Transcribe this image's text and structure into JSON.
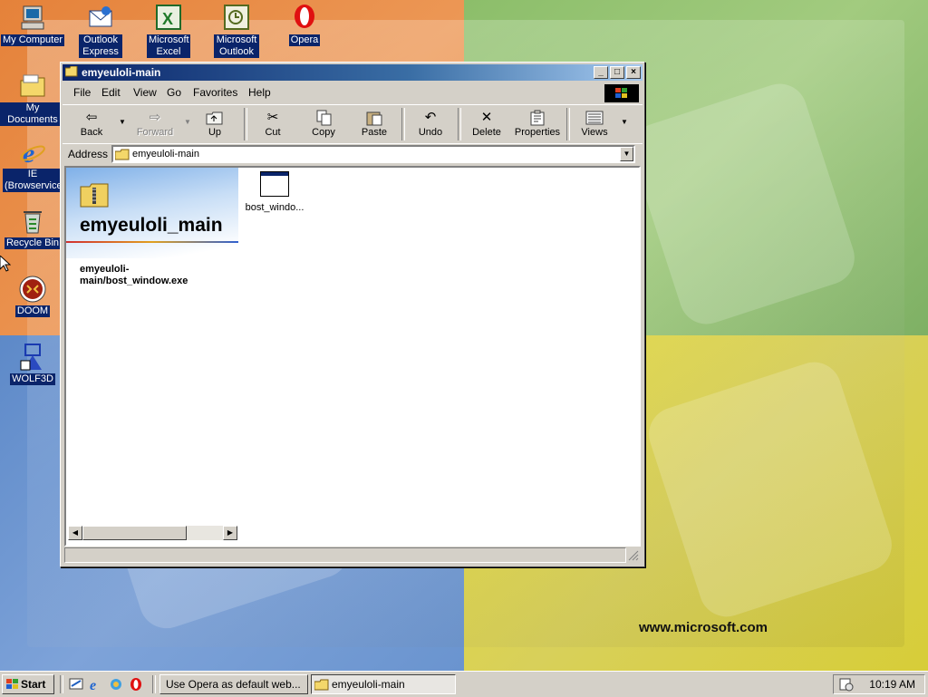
{
  "desktop": {
    "brand_text": "www.microsoft.com",
    "icons": [
      {
        "label": "My Computer",
        "icon": "computer-icon"
      },
      {
        "label": "Outlook Express",
        "icon": "outlook-express-icon"
      },
      {
        "label": "Microsoft Excel",
        "icon": "excel-icon"
      },
      {
        "label": "Microsoft Outlook",
        "icon": "outlook-icon"
      },
      {
        "label": "Opera",
        "icon": "opera-icon"
      },
      {
        "label": "My Documents",
        "icon": "folder-icon"
      },
      {
        "label": "IE (Browservice)",
        "icon": "ie-icon"
      },
      {
        "label": "Recycle Bin",
        "icon": "recycle-bin-icon"
      },
      {
        "label": "DOOM",
        "icon": "doom-icon"
      },
      {
        "label": "WOLF3D",
        "icon": "wolf3d-icon"
      }
    ]
  },
  "window": {
    "title": "emyeuloli-main",
    "menus": [
      {
        "label": "File"
      },
      {
        "label": "Edit"
      },
      {
        "label": "View"
      },
      {
        "label": "Go"
      },
      {
        "label": "Favorites"
      },
      {
        "label": "Help"
      }
    ],
    "toolbar": [
      {
        "label": "Back",
        "icon": "back-arrow-icon",
        "enabled": true
      },
      {
        "label": "Forward",
        "icon": "forward-arrow-icon",
        "enabled": false
      },
      {
        "label": "Up",
        "icon": "up-folder-icon",
        "enabled": true
      },
      {
        "label": "Cut",
        "icon": "scissors-icon",
        "enabled": true
      },
      {
        "label": "Copy",
        "icon": "copy-icon",
        "enabled": true
      },
      {
        "label": "Paste",
        "icon": "paste-icon",
        "enabled": true
      },
      {
        "label": "Undo",
        "icon": "undo-icon",
        "enabled": true
      },
      {
        "label": "Delete",
        "icon": "delete-x-icon",
        "enabled": true
      },
      {
        "label": "Properties",
        "icon": "properties-icon",
        "enabled": true
      },
      {
        "label": "Views",
        "icon": "views-icon",
        "enabled": true
      }
    ],
    "address": {
      "label": "Address",
      "value": "emyeuloli-main"
    },
    "web_panel": {
      "folder_title": "emyeuloli_main",
      "selection_path": "emyeuloli-main/bost_window.exe"
    },
    "files": [
      {
        "name": "bost_windo...",
        "icon": "exe-window-icon"
      }
    ]
  },
  "taskbar": {
    "start_label": "Start",
    "quick_launch": [
      "show-desktop-icon",
      "ie-icon",
      "channels-icon",
      "opera-icon"
    ],
    "tasks": [
      {
        "label": "Use Opera as default web...",
        "active": false
      },
      {
        "label": "emyeuloli-main",
        "active": true
      }
    ],
    "clock": "10:19 AM"
  }
}
